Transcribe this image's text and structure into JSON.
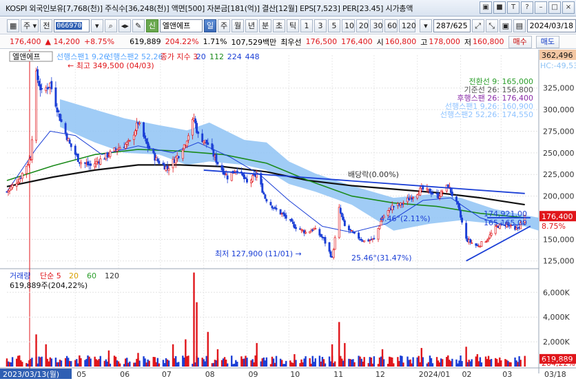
{
  "window": {
    "title": "KOSPI 외국인보유[7,768(천)] 주식수[36,248(천)] 액면[500] 자본금[181(억)] 결산[12월] EPS[7,523] PER[23.45] 시가총액",
    "buttons": [
      "▣",
      "■",
      "T",
      "?",
      "–",
      "□",
      "×"
    ]
  },
  "toolbar": {
    "market_select": "주",
    "prev_label": "전",
    "code": "066970",
    "badge": "신",
    "stock_name": "엘앤에프",
    "periods": [
      "일",
      "주",
      "월",
      "년",
      "분",
      "초",
      "틱"
    ],
    "active_period": "일",
    "intervals": [
      "1",
      "3",
      "5",
      "10",
      "20",
      "30",
      "60",
      "120"
    ],
    "counter": "287/625",
    "date": "2024/03/18"
  },
  "quote": {
    "price": "176,400",
    "change": "▲ 14,200",
    "change_pct": "+8.75%",
    "volume": "619,889",
    "volume_pct": "204.22%",
    "turnover": "1.71%",
    "amount": "107,529백만",
    "best_label": "최우선",
    "best_ask": "176,500",
    "best_bid": "176,400",
    "open_label": "시",
    "open": "160,800",
    "high_label": "고",
    "high": "178,000",
    "low_label": "저",
    "low": "160,800",
    "buy_label": "매수",
    "sell_label": "매도"
  },
  "chart_data": {
    "type": "candlestick",
    "title": "엘앤에프",
    "legend": [
      {
        "name": "선행스팬1 9,26",
        "color": "#5aa7ff"
      },
      {
        "name": "선행스팬2 52,26",
        "color": "#5aa7ff"
      },
      {
        "name": "종가 지수 3",
        "color": "#e0161b"
      },
      {
        "name": "20",
        "color": "#1b3fd6"
      },
      {
        "name": "112",
        "color": "#1a8a1a"
      },
      {
        "name": "224",
        "color": "#1b3fd6"
      },
      {
        "name": "448",
        "color": "#1b3fd6"
      }
    ],
    "y_ticks": [
      325000,
      300000,
      275000,
      250000,
      225000,
      200000,
      175000,
      150000,
      125000
    ],
    "y_tick_labels": [
      "325,000",
      "300,000",
      "275,000",
      "250,000",
      "225,000",
      "200,000",
      "175,000",
      "150,000",
      "125,000"
    ],
    "ylim": [
      116000,
      363000
    ],
    "y_top_label": "362,496",
    "y_top_label2": "HC:-49,53",
    "current_price_label": "176,400",
    "current_pct_label": "8.75%",
    "x_labels": [
      "2023/03/13(월)",
      "05",
      "06",
      "07",
      "08",
      "09",
      "10",
      "11",
      "12",
      "2024/01",
      "02",
      "03",
      "03/18"
    ],
    "x_months": [
      "2023-03",
      "2023-05",
      "2023-06",
      "2023-07",
      "2023-08",
      "2023-09",
      "2023-10",
      "2023-11",
      "2023-12",
      "2024-01",
      "2024-02",
      "2024-03"
    ],
    "close_path": [
      [
        "2023-03-13",
        205000
      ],
      [
        "2023-03-22",
        220000
      ],
      [
        "2023-03-30",
        245000
      ],
      [
        "2023-04-03",
        340000
      ],
      [
        "2023-04-07",
        320000
      ],
      [
        "2023-04-13",
        330000
      ],
      [
        "2023-04-20",
        290000
      ],
      [
        "2023-04-27",
        260000
      ],
      [
        "2023-05-04",
        240000
      ],
      [
        "2023-05-12",
        235000
      ],
      [
        "2023-05-22",
        245000
      ],
      [
        "2023-05-31",
        255000
      ],
      [
        "2023-06-09",
        262000
      ],
      [
        "2023-06-15",
        285000
      ],
      [
        "2023-06-21",
        260000
      ],
      [
        "2023-06-28",
        242000
      ],
      [
        "2023-07-06",
        232000
      ],
      [
        "2023-07-14",
        248000
      ],
      [
        "2023-07-19",
        262000
      ],
      [
        "2023-07-25",
        290000
      ],
      [
        "2023-07-28",
        270000
      ],
      [
        "2023-08-04",
        260000
      ],
      [
        "2023-08-11",
        238000
      ],
      [
        "2023-08-18",
        222000
      ],
      [
        "2023-08-25",
        232000
      ],
      [
        "2023-09-01",
        215000
      ],
      [
        "2023-09-08",
        225000
      ],
      [
        "2023-09-14",
        198000
      ],
      [
        "2023-09-21",
        185000
      ],
      [
        "2023-09-27",
        178000
      ],
      [
        "2023-10-05",
        165000
      ],
      [
        "2023-10-13",
        158000
      ],
      [
        "2023-10-19",
        162000
      ],
      [
        "2023-10-26",
        150000
      ],
      [
        "2023-11-01",
        127900
      ],
      [
        "2023-11-06",
        185000
      ],
      [
        "2023-11-10",
        165000
      ],
      [
        "2023-11-17",
        155000
      ],
      [
        "2023-11-24",
        148000
      ],
      [
        "2023-12-01",
        150000
      ],
      [
        "2023-12-07",
        175000
      ],
      [
        "2023-12-14",
        188000
      ],
      [
        "2023-12-20",
        190000
      ],
      [
        "2023-12-27",
        198000
      ],
      [
        "2024-01-04",
        208000
      ],
      [
        "2024-01-10",
        205000
      ],
      [
        "2024-01-16",
        200000
      ],
      [
        "2024-01-23",
        212000
      ],
      [
        "2024-01-30",
        188000
      ],
      [
        "2024-02-05",
        150000
      ],
      [
        "2024-02-13",
        142000
      ],
      [
        "2024-02-20",
        150000
      ],
      [
        "2024-02-27",
        165000
      ],
      [
        "2024-03-05",
        168000
      ],
      [
        "2024-03-11",
        160000
      ],
      [
        "2024-03-14",
        165000
      ],
      [
        "2024-03-18",
        176400
      ]
    ],
    "ma20_path": [
      [
        "2023-03-13",
        205000
      ],
      [
        "2023-04-03",
        255000
      ],
      [
        "2023-04-13",
        275000
      ],
      [
        "2023-05-01",
        270000
      ],
      [
        "2023-05-20",
        248000
      ],
      [
        "2023-06-15",
        258000
      ],
      [
        "2023-07-10",
        250000
      ],
      [
        "2023-07-28",
        262000
      ],
      [
        "2023-08-20",
        245000
      ],
      [
        "2023-09-10",
        225000
      ],
      [
        "2023-10-01",
        195000
      ],
      [
        "2023-10-25",
        165000
      ],
      [
        "2023-11-15",
        158000
      ],
      [
        "2023-12-10",
        168000
      ],
      [
        "2024-01-05",
        195000
      ],
      [
        "2024-01-25",
        198000
      ],
      [
        "2024-02-15",
        175000
      ],
      [
        "2024-03-05",
        165000
      ],
      [
        "2024-03-18",
        168000
      ]
    ],
    "ma112_path": [
      [
        "2023-03-13",
        218000
      ],
      [
        "2023-04-15",
        235000
      ],
      [
        "2023-05-15",
        248000
      ],
      [
        "2023-06-15",
        254000
      ],
      [
        "2023-07-15",
        252000
      ],
      [
        "2023-08-15",
        248000
      ],
      [
        "2023-09-15",
        238000
      ],
      [
        "2023-10-15",
        218000
      ],
      [
        "2023-11-15",
        200000
      ],
      [
        "2023-12-15",
        192000
      ],
      [
        "2024-01-15",
        188000
      ],
      [
        "2024-02-15",
        180000
      ],
      [
        "2024-03-18",
        175000
      ]
    ],
    "ma224_path": [
      [
        "2023-03-13",
        211000
      ],
      [
        "2023-04-15",
        222000
      ],
      [
        "2023-05-15",
        230000
      ],
      [
        "2023-06-15",
        236000
      ],
      [
        "2023-07-15",
        236000
      ],
      [
        "2023-08-15",
        234000
      ],
      [
        "2023-09-15",
        228000
      ],
      [
        "2023-10-15",
        218000
      ],
      [
        "2023-11-15",
        212000
      ],
      [
        "2023-12-15",
        208000
      ],
      [
        "2024-01-15",
        204000
      ],
      [
        "2024-02-15",
        198000
      ],
      [
        "2024-03-18",
        190000
      ]
    ],
    "cloud_path_top": [
      [
        "2023-04-20",
        312000
      ],
      [
        "2023-05-15",
        300000
      ],
      [
        "2023-06-05",
        290000
      ],
      [
        "2023-06-30",
        282000
      ],
      [
        "2023-07-20",
        276000
      ],
      [
        "2023-08-05",
        285000
      ],
      [
        "2023-08-30",
        265000
      ],
      [
        "2023-09-15",
        262000
      ],
      [
        "2023-10-01",
        240000
      ],
      [
        "2023-10-20",
        226000
      ],
      [
        "2023-11-15",
        212000
      ],
      [
        "2023-12-15",
        198000
      ],
      [
        "2024-01-10",
        202000
      ],
      [
        "2024-02-01",
        198000
      ],
      [
        "2024-02-25",
        185000
      ],
      [
        "2024-03-18",
        178000
      ],
      [
        "2024-03-28",
        175000
      ]
    ],
    "cloud_path_bottom": [
      [
        "2023-04-20",
        280000
      ],
      [
        "2023-05-15",
        262000
      ],
      [
        "2023-06-05",
        250000
      ],
      [
        "2023-06-30",
        248000
      ],
      [
        "2023-07-20",
        236000
      ],
      [
        "2023-08-05",
        240000
      ],
      [
        "2023-08-30",
        236000
      ],
      [
        "2023-09-15",
        230000
      ],
      [
        "2023-10-01",
        214000
      ],
      [
        "2023-10-20",
        205000
      ],
      [
        "2023-11-15",
        190000
      ],
      [
        "2023-12-15",
        160000
      ],
      [
        "2024-01-10",
        168000
      ],
      [
        "2024-02-01",
        172000
      ],
      [
        "2024-02-25",
        168000
      ],
      [
        "2024-03-18",
        165000
      ],
      [
        "2024-03-28",
        160000
      ]
    ],
    "trendline_upper": [
      [
        "2023-08-01",
        230000
      ],
      [
        "2024-03-18",
        203000
      ]
    ],
    "trendline_flat": [
      [
        "2024-02-20",
        174921
      ],
      [
        "2024-03-22",
        174921
      ]
    ],
    "trendline_rising": [
      [
        "2024-02-05",
        125000
      ],
      [
        "2024-03-22",
        165165
      ]
    ],
    "ichimoku_labels": [
      {
        "text": "전환선 9: 165,000",
        "color": "#2a9d2a"
      },
      {
        "text": "기준선 26: 156,800",
        "color": "#555555"
      },
      {
        "text": "후행스팬 26: 176,400",
        "color": "#8a2ca8"
      },
      {
        "text": "선행스팬1 9,26: 160,900",
        "color": "#8fc3ff"
      },
      {
        "text": "선행스팬2 52,26: 174,550",
        "color": "#8fc3ff"
      }
    ],
    "annotations": [
      {
        "text": "최고 349,500 (04/03)",
        "color": "#e0161b"
      },
      {
        "text": "최저 127,900 (11/01)",
        "color": "#1b3fd6"
      },
      {
        "text": "배당락(0.00%)",
        "color": "#333333"
      },
      {
        "text": "4.46°(2.11%)",
        "color": "#1b3fd6"
      },
      {
        "text": "25.46°(31.47%)",
        "color": "#1b3fd6"
      },
      {
        "text": "174,921.00",
        "color": "#1b3fd6"
      },
      {
        "text": "165,165.00",
        "color": "#1b3fd6"
      }
    ],
    "volume": {
      "legend": [
        "거래량",
        "단순 5",
        "20",
        "60",
        "120"
      ],
      "legend_colors": [
        "#1b3fd6",
        "#e0161b",
        "#d8a000",
        "#2a9d2a",
        "#333333"
      ],
      "current_text": "619,889주(204,22%)",
      "y_ticks": [
        6000000,
        4000000,
        2000000
      ],
      "y_tick_labels": [
        "6,000K",
        "4,000K",
        "2,000K"
      ],
      "ylim": [
        0,
        7800000
      ],
      "current_label": "619,889",
      "current_pct": "204,22%",
      "spikes": [
        [
          "2023-03-13",
          500000
        ],
        [
          "2023-03-22",
          900000
        ],
        [
          "2023-04-03",
          2600000
        ],
        [
          "2023-04-10",
          1800000
        ],
        [
          "2023-05-04",
          900000
        ],
        [
          "2023-05-25",
          1300000
        ],
        [
          "2023-06-15",
          1100000
        ],
        [
          "2023-07-10",
          1800000
        ],
        [
          "2023-07-19",
          2200000
        ],
        [
          "2023-07-25",
          7600000
        ],
        [
          "2023-07-27",
          5200000
        ],
        [
          "2023-08-04",
          2800000
        ],
        [
          "2023-08-11",
          1400000
        ],
        [
          "2023-09-08",
          1900000
        ],
        [
          "2023-10-05",
          1000000
        ],
        [
          "2023-10-26",
          600000
        ],
        [
          "2023-11-01",
          1800000
        ],
        [
          "2023-11-06",
          3600000
        ],
        [
          "2023-11-10",
          1900000
        ],
        [
          "2023-12-07",
          1400000
        ],
        [
          "2024-01-04",
          1500000
        ],
        [
          "2024-01-23",
          900000
        ],
        [
          "2024-02-05",
          1600000
        ],
        [
          "2024-02-13",
          1000000
        ],
        [
          "2024-03-18",
          619889
        ]
      ]
    }
  }
}
